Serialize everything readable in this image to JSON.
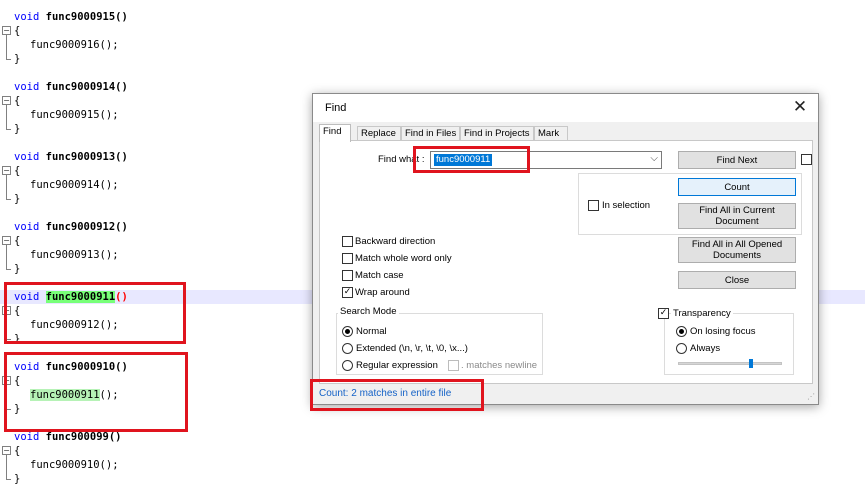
{
  "editor": {
    "keyword": "void",
    "open_brace": "{",
    "close_brace": "}",
    "call_suffix": "();",
    "func_suffix": "()",
    "blocks": [
      {
        "func": "func9000915",
        "call": "func9000916"
      },
      {
        "func": "func9000914",
        "call": "func9000915"
      },
      {
        "func": "func9000913",
        "call": "func9000914"
      },
      {
        "func": "func9000912",
        "call": "func9000913"
      },
      {
        "func": "func9000911",
        "call": "func9000912"
      },
      {
        "func": "func9000910",
        "call": "func9000911"
      },
      {
        "func": "func900099",
        "call": "func9000910"
      }
    ]
  },
  "find_dialog": {
    "title": "Find",
    "close_icon": "close-icon",
    "tabs": [
      "Find",
      "Replace",
      "Find in Files",
      "Find in Projects",
      "Mark"
    ],
    "active_tab": "Find",
    "find_what_label": "Find what :",
    "find_what_value": "func9000911",
    "dropdown_icon": "chevron-down-icon",
    "in_selection_label": "In selection",
    "buttons": {
      "find_next": "Find Next",
      "count": "Count",
      "find_all_current": "Find All in Current Document",
      "find_all_opened": "Find All in All Opened Documents",
      "close": "Close"
    },
    "options": {
      "backward": "Backward direction",
      "whole_word": "Match whole word only",
      "match_case": "Match case",
      "wrap_around": "Wrap around"
    },
    "search_mode": {
      "title": "Search Mode",
      "normal": "Normal",
      "extended": "Extended (\\n, \\r, \\t, \\0, \\x...)",
      "regex": "Regular expression",
      "matches_newline": ". matches newline"
    },
    "transparency": {
      "title": "Transparency",
      "on_losing_focus": "On losing focus",
      "always": "Always",
      "level": 0.7
    },
    "status": "Count: 2 matches in entire file"
  },
  "colors": {
    "keyword": "#0000ff",
    "match_highlight": "#78ff78",
    "annotation_box": "#e0141e",
    "status_text": "#1462c7"
  }
}
